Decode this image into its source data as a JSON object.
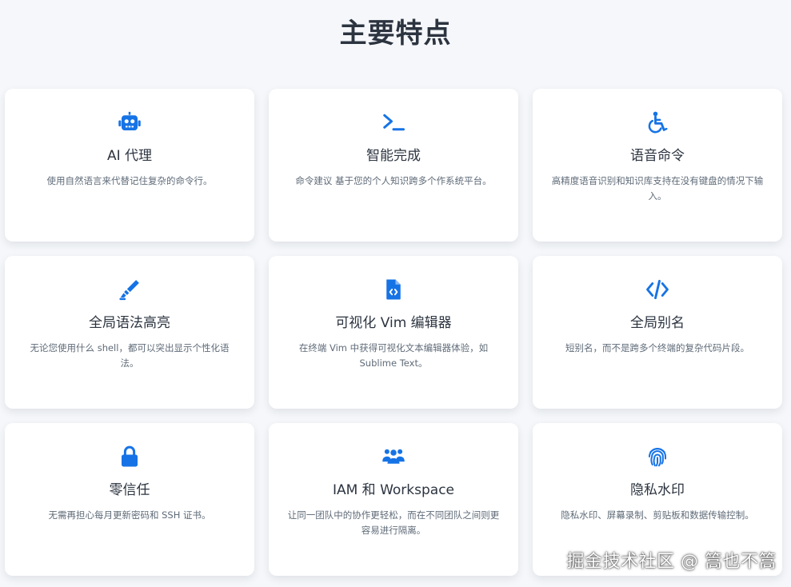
{
  "page": {
    "title": "主要特点"
  },
  "accent_color": "#1673e6",
  "features": [
    {
      "icon": "robot-icon",
      "title": "AI 代理",
      "desc": "使用自然语言来代替记住复杂的命令行。"
    },
    {
      "icon": "terminal-icon",
      "title": "智能完成",
      "desc": "命令建议 基于您的个人知识跨多个作系统平台。"
    },
    {
      "icon": "wheelchair-icon",
      "title": "语音命令",
      "desc": "高精度语音识别和知识库支持在没有键盘的情况下输入。"
    },
    {
      "icon": "highlighter-icon",
      "title": "全局语法高亮",
      "desc": "无论您使用什么 shell，都可以突出显示个性化语法。"
    },
    {
      "icon": "file-code-icon",
      "title": "可视化 Vim 编辑器",
      "desc": "在终端 Vim 中获得可视化文本编辑器体验，如 Sublime Text。"
    },
    {
      "icon": "code-icon",
      "title": "全局别名",
      "desc": "短别名，而不是跨多个终端的复杂代码片段。"
    },
    {
      "icon": "lock-icon",
      "title": "零信任",
      "desc": "无需再担心每月更新密码和 SSH 证书。"
    },
    {
      "icon": "users-icon",
      "title": "IAM 和 Workspace",
      "desc": "让同一团队中的协作更轻松，而在不同团队之间则更容易进行隔离。"
    },
    {
      "icon": "fingerprint-icon",
      "title": "隐私水印",
      "desc": "隐私水印、屏幕录制、剪贴板和数据传输控制。"
    }
  ],
  "watermark": "掘金技术社区 @ 篙也不篙"
}
